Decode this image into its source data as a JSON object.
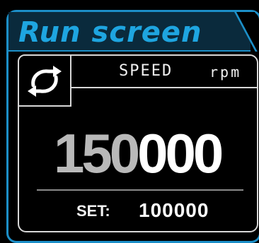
{
  "screen": {
    "title": "Run screen"
  },
  "speed_panel": {
    "label": "SPEED",
    "unit": "rpm",
    "actual_value_dim_part": "150",
    "actual_value_bright_part": "000",
    "set_label": "SET:",
    "set_value": "100000",
    "icon": "refresh-icon"
  },
  "colors": {
    "accent": "#1c8fc8",
    "title_text": "#1ea5e0",
    "panel_border": "#d8d8d8",
    "value_dim": "#b9b9b9",
    "value_bright": "#ffffff",
    "background": "#000000"
  }
}
